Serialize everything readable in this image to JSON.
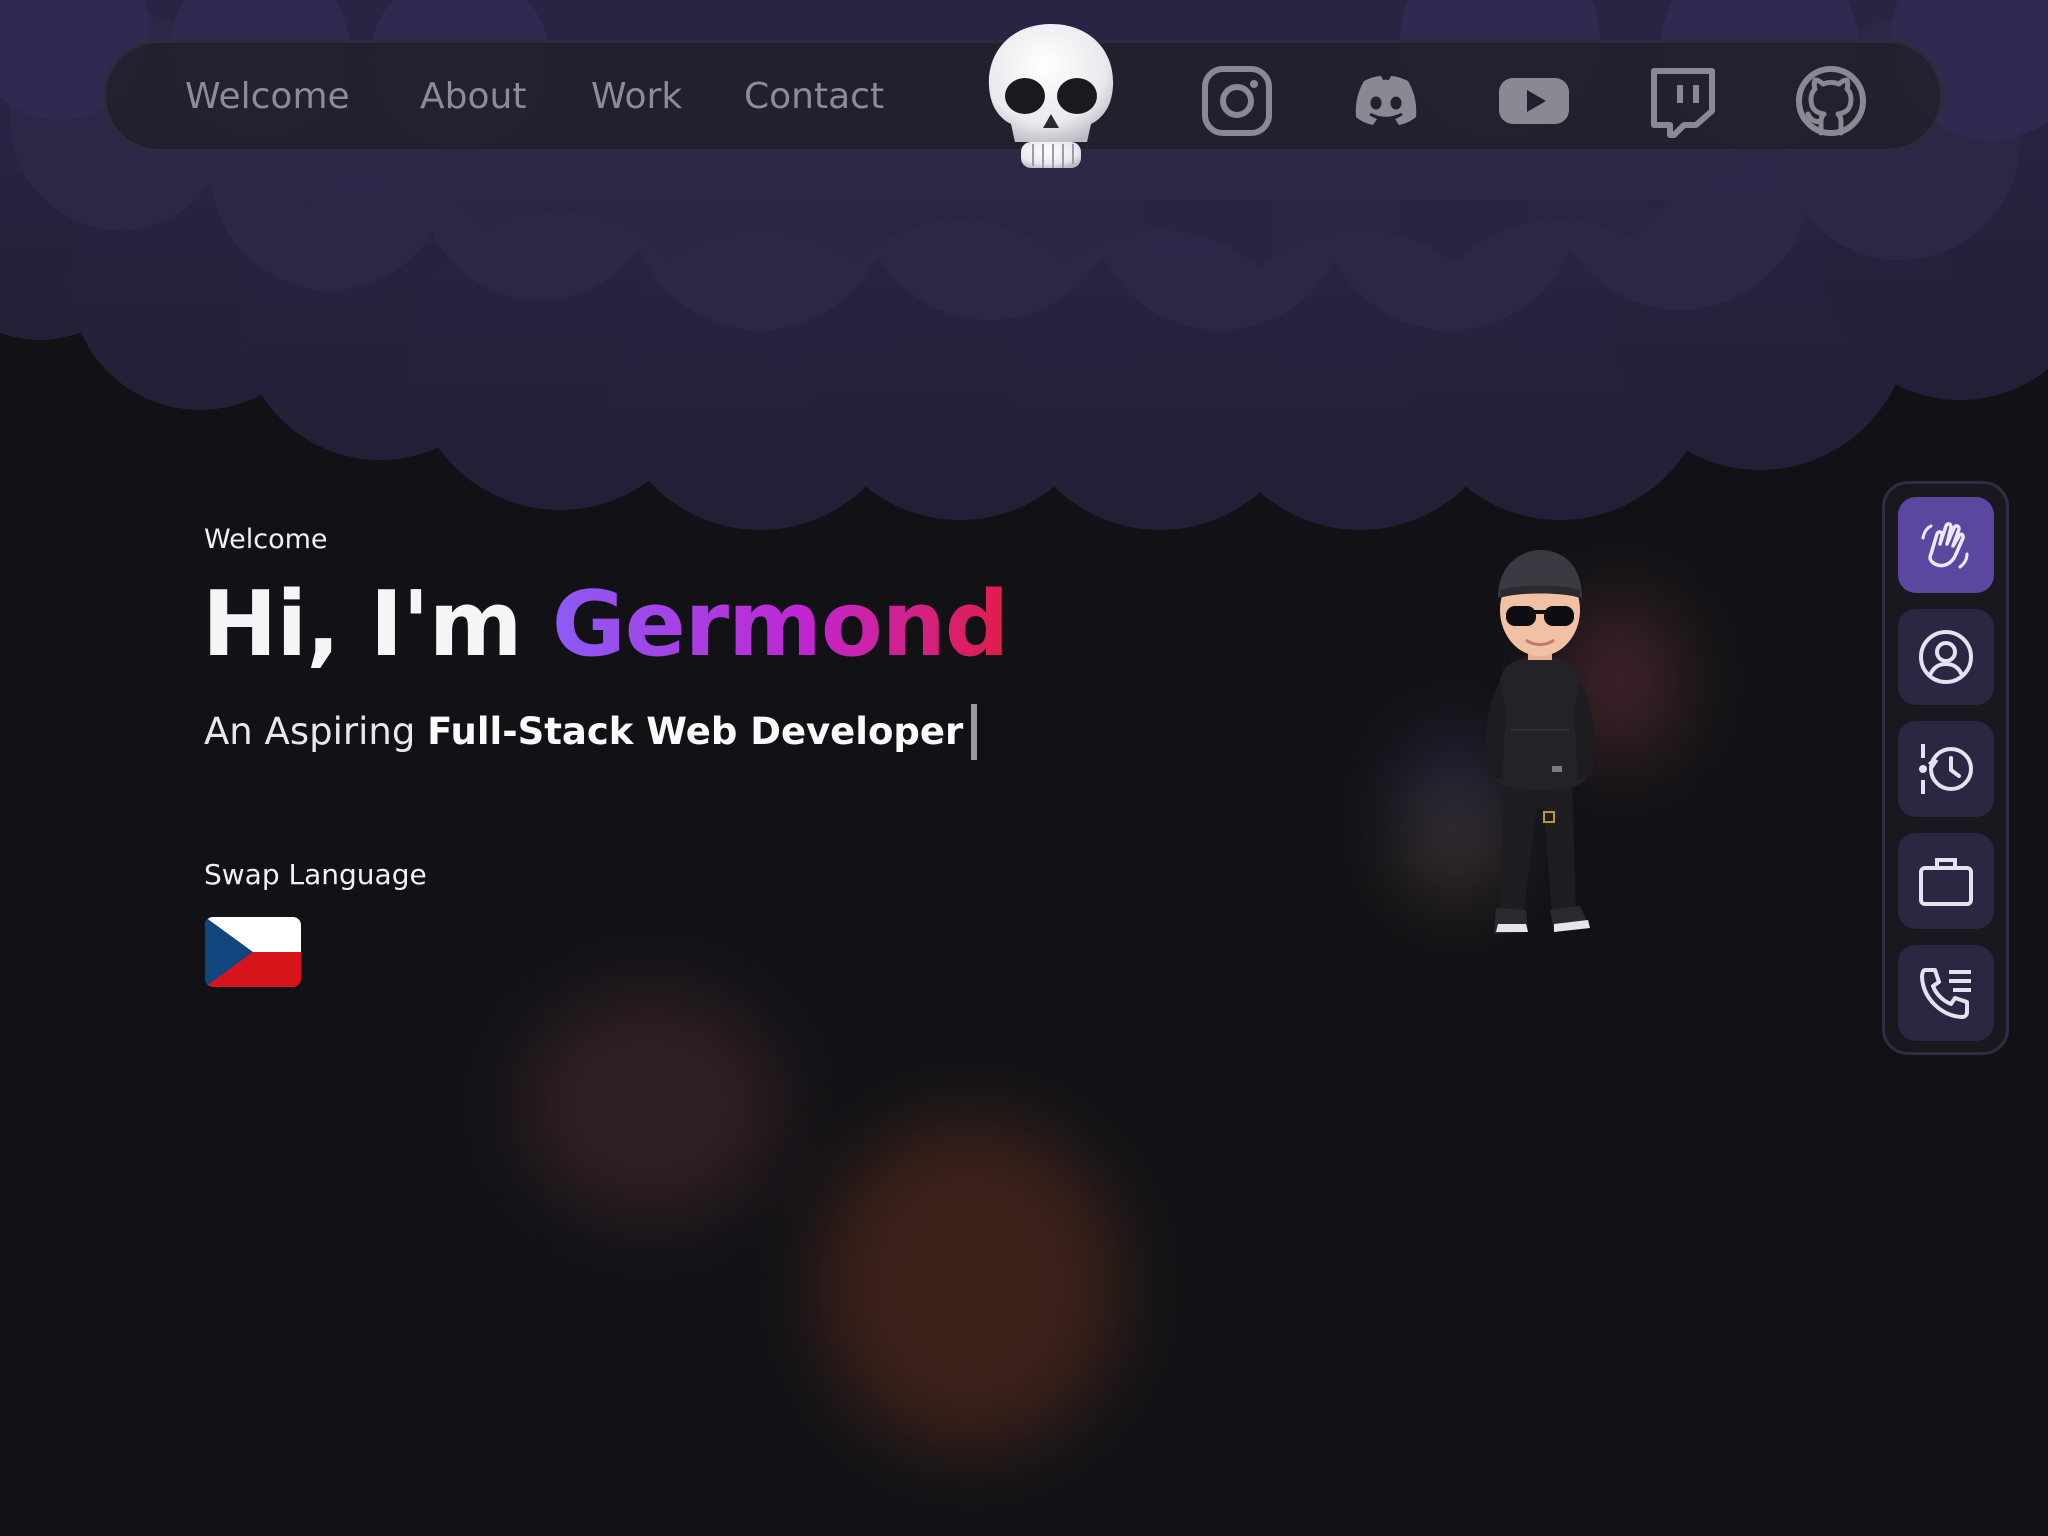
{
  "nav": {
    "links": [
      {
        "label": "Welcome"
      },
      {
        "label": "About"
      },
      {
        "label": "Work"
      },
      {
        "label": "Contact"
      }
    ],
    "logo_icon": "skull-icon",
    "socials": [
      {
        "icon": "instagram-icon"
      },
      {
        "icon": "discord-icon"
      },
      {
        "icon": "youtube-icon"
      },
      {
        "icon": "twitch-icon"
      },
      {
        "icon": "github-icon"
      }
    ]
  },
  "hero": {
    "kicker": "Welcome",
    "greeting": "Hi, I'm ",
    "name": "Germond",
    "subtitle_prefix": "An Aspiring ",
    "subtitle_emphasis": "Full-Stack Web Developer",
    "swap_language_label": "Swap Language",
    "language_flag_icon": "czech-flag-icon"
  },
  "side_rail": {
    "items": [
      {
        "icon": "waving-hand-icon",
        "active": true
      },
      {
        "icon": "user-circle-icon",
        "active": false
      },
      {
        "icon": "timeline-history-icon",
        "active": false
      },
      {
        "icon": "briefcase-icon",
        "active": false
      },
      {
        "icon": "phone-list-icon",
        "active": false
      }
    ]
  },
  "colors": {
    "accent_gradient": [
      "#8b5cf6",
      "#c026d3",
      "#e11d48"
    ],
    "rail_active": "#5b47a0",
    "rail_inactive": "#2a2742",
    "background": "#121216",
    "cloud": "#2b2440"
  }
}
